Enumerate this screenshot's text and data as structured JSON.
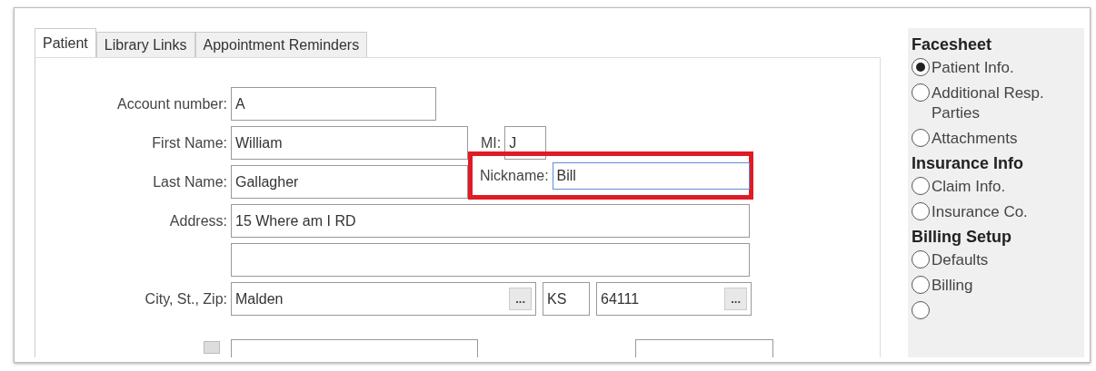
{
  "tabs": [
    {
      "label": "Patient",
      "selected": true
    },
    {
      "label": "Library Links",
      "selected": false
    },
    {
      "label": "Appointment Reminders",
      "selected": false
    }
  ],
  "form": {
    "account_number": {
      "label": "Account number:",
      "value": "A"
    },
    "first_name": {
      "label": "First Name:",
      "value": "William"
    },
    "mi": {
      "label": "MI:",
      "value": "J"
    },
    "last_name": {
      "label": "Last Name:",
      "value": "Gallagher"
    },
    "nickname": {
      "label": "Nickname:",
      "value": "Bill",
      "highlighted": true
    },
    "address": {
      "label": "Address:",
      "value": "15 Where am I RD"
    },
    "city_st_zip": {
      "label": "City, St., Zip:",
      "city": "Malden",
      "state": "KS",
      "zip": "64111",
      "lookup_button": "..."
    }
  },
  "sidebar": [
    {
      "title": "Facesheet",
      "items": [
        {
          "label": "Patient Info.",
          "selected": true
        },
        {
          "label": "Additional Resp. Parties",
          "selected": false
        },
        {
          "label": "Attachments",
          "selected": false
        }
      ]
    },
    {
      "title": "Insurance Info",
      "items": [
        {
          "label": "Claim Info.",
          "selected": false
        },
        {
          "label": "Insurance Co.",
          "selected": false
        }
      ]
    },
    {
      "title": "Billing Setup",
      "items": [
        {
          "label": "Defaults",
          "selected": false
        },
        {
          "label": "Billing",
          "selected": false
        }
      ]
    }
  ]
}
